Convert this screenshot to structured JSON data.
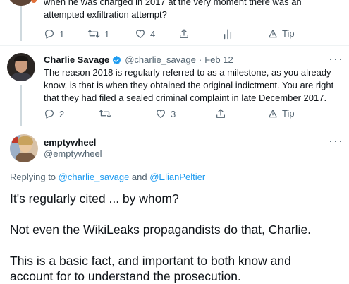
{
  "tweet1": {
    "text_lines": [
      "when he was charged in 2017 at the very moment there was an",
      "attempted exfiltration attempt?"
    ],
    "actions": {
      "reply_count": "1",
      "retweet_count": "1",
      "like_count": "4",
      "tip_label": "Tip"
    }
  },
  "tweet2": {
    "name": "Charlie Savage",
    "handle": "@charlie_savage",
    "dot": "·",
    "date": "Feb 12",
    "text_lines": [
      "The reason 2018 is regularly referred to as a milestone, as you already",
      "know, is that is when they obtained the original indictment. You are right",
      "that they had filed a sealed criminal complaint in late December 2017."
    ],
    "actions": {
      "reply_count": "2",
      "retweet_count": "",
      "like_count": "3",
      "tip_label": "Tip"
    }
  },
  "tweet3": {
    "name": "emptywheel",
    "handle": "@emptywheel",
    "replying_prefix": "Replying to ",
    "replying_user1": "@charlie_savage",
    "replying_and": " and ",
    "replying_user2": "@ElianPeltier",
    "text_lines": [
      "It's regularly cited ... by whom?",
      "Not even the WikiLeaks propagandists do that, Charlie.",
      "This is a basic fact, and important to both know and",
      "account for to understand the prosecution."
    ]
  },
  "colors": {
    "accent": "#1d9bf0",
    "text": "#0f1419",
    "secondary": "#536471",
    "thread_line": "#cfd9de"
  }
}
